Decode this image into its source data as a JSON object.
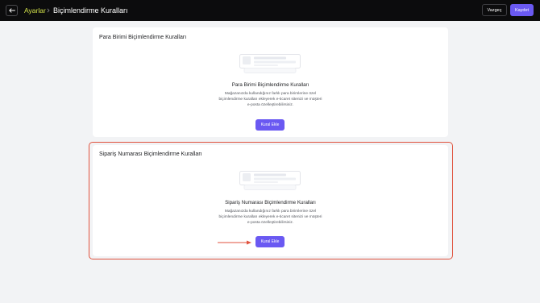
{
  "header": {
    "back_icon": "arrow-left-icon",
    "breadcrumb_root": "Ayarlar",
    "breadcrumb_separator_icon": "chevron-right-icon",
    "title": "Biçimlendirme Kuralları",
    "cancel_label": "Vazgeç",
    "save_label": "Kaydet"
  },
  "sections": [
    {
      "title": "Para Birimi Biçimlendirme Kuralları",
      "empty_title": "Para Birimi Biçimlendirme Kuralları",
      "empty_desc": "Mağazanızda kullandığınız farklı para birimlerine özel biçimlendirme kuralları ekleyerek e-ticaret sitenizi ve müşteri e-posta özelleştirebilirsiniz.",
      "add_label": "Kural Ekle"
    },
    {
      "title": "Sipariş Numarası Biçimlendirme Kuralları",
      "empty_title": "Sipariş Numarası Biçimlendirme Kuralları",
      "empty_desc": "Mağazanızda kullandığınız farklı para birimlerine özel biçimlendirme kuralları ekleyerek e-ticaret sitenizi ve müşteri e-posta özelleştirebilirsiniz.",
      "add_label": "Kural Ekle"
    }
  ],
  "colors": {
    "topbar": "#0c0c0d",
    "accent": "#6a59f2",
    "breadcrumb": "#d4e34b",
    "highlight": "#e0523d"
  },
  "annotation_icon": "red-arrow-pointer-icon"
}
